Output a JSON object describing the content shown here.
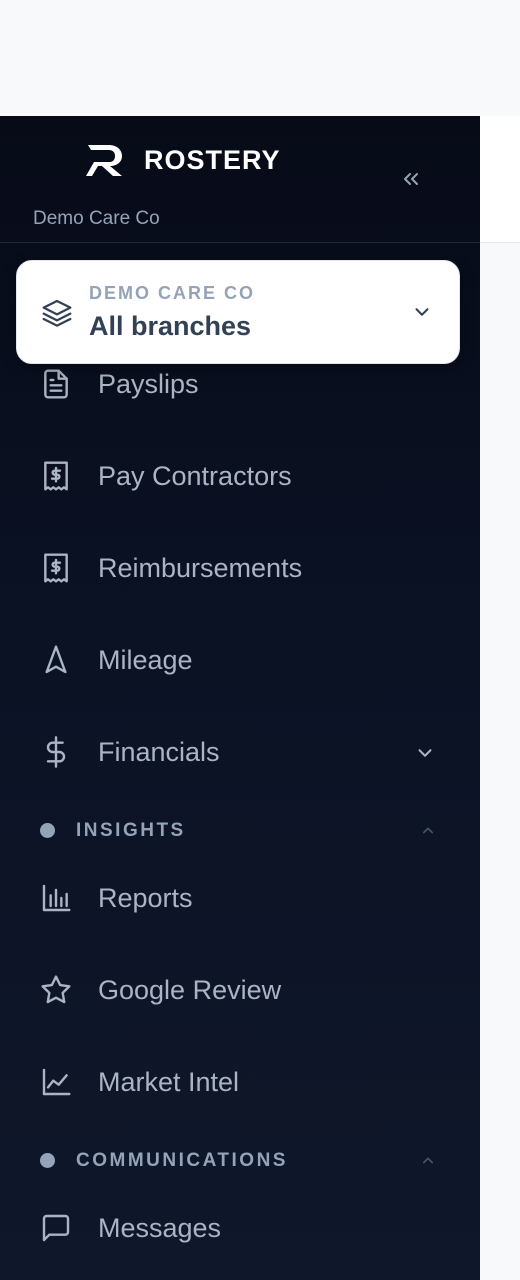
{
  "brand": {
    "name": "ROSTERY",
    "logo_icon": "rostery-r-logo"
  },
  "sidebar": {
    "collapse_icon": "double-chevron-left-icon",
    "org_subtitle": "Demo Care Co",
    "branch_selector": {
      "org": "DEMO CARE CO",
      "branch": "All branches",
      "icon": "layers-icon",
      "chevron": "chevron-down-icon"
    },
    "items": [
      {
        "label": "Payslips",
        "icon": "file-text-icon"
      },
      {
        "label": "Pay Contractors",
        "icon": "receipt-dollar-icon"
      },
      {
        "label": "Reimbursements",
        "icon": "receipt-dollar-icon"
      },
      {
        "label": "Mileage",
        "icon": "navigation-arrow-icon"
      },
      {
        "label": "Financials",
        "icon": "dollar-icon",
        "expandable": true,
        "expanded": false
      }
    ],
    "sections": [
      {
        "label": "INSIGHTS",
        "expanded": true,
        "items": [
          {
            "label": "Reports",
            "icon": "bar-chart-icon"
          },
          {
            "label": "Google Review",
            "icon": "star-icon"
          },
          {
            "label": "Market Intel",
            "icon": "line-chart-icon"
          }
        ]
      },
      {
        "label": "COMMUNICATIONS",
        "expanded": true,
        "items": [
          {
            "label": "Messages",
            "icon": "message-square-icon"
          }
        ]
      }
    ]
  },
  "colors": {
    "sidebar_bg": "#0b1224",
    "nav_text": "#aab4c3",
    "section_text": "#94a3b8",
    "selector_bg": "#ffffff",
    "selector_text": "#334155"
  }
}
